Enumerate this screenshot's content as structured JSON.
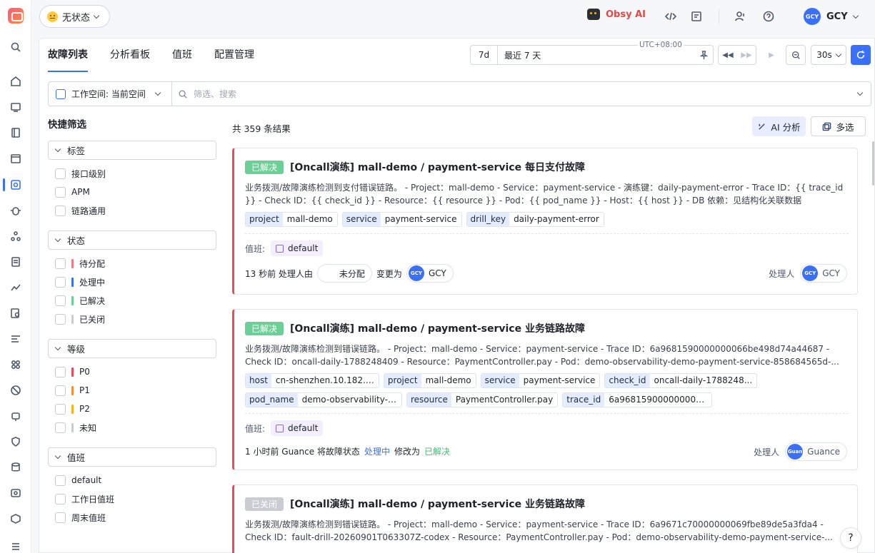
{
  "header": {
    "status_label": "无状态",
    "obsy_label": "Obsy AI",
    "user_initials": "GCY",
    "user_name": "GCY"
  },
  "tabs": [
    {
      "label": "故障列表",
      "active": true
    },
    {
      "label": "分析看板",
      "active": false
    },
    {
      "label": "值班",
      "active": false
    },
    {
      "label": "配置管理",
      "active": false
    }
  ],
  "time": {
    "range": "7d",
    "label": "最近 7 天",
    "timezone": "UTC+08:00",
    "interval": "30s"
  },
  "filter": {
    "workspace": "工作空间: 当前空间",
    "search_placeholder": "筛选、搜索"
  },
  "quick_filter": {
    "title": "快捷筛选",
    "groups": [
      {
        "label": "标签",
        "items": [
          {
            "label": "接口级别"
          },
          {
            "label": "APM"
          },
          {
            "label": "链路通用"
          }
        ]
      },
      {
        "label": "状态",
        "items": [
          {
            "label": "待分配",
            "color": "#f07a86"
          },
          {
            "label": "处理中",
            "color": "#3a6ff7"
          },
          {
            "label": "已解决",
            "color": "#6ccf95"
          },
          {
            "label": "已关闭",
            "color": "#c9ccd2"
          }
        ]
      },
      {
        "label": "等级",
        "items": [
          {
            "label": "P0",
            "color": "#e94b5b"
          },
          {
            "label": "P1",
            "color": "#ff8a3c"
          },
          {
            "label": "P2",
            "color": "#ffb020"
          },
          {
            "label": "未知",
            "color": "#c9ccd2"
          }
        ]
      },
      {
        "label": "值班",
        "items": [
          {
            "label": "default"
          },
          {
            "label": "工作日值班"
          },
          {
            "label": "周末值班"
          }
        ]
      }
    ]
  },
  "results": {
    "count_text": "共 359 条结果",
    "ai_label": "AI 分析",
    "multi_label": "多选"
  },
  "cards": [
    {
      "status": "已解决",
      "title": "[Oncall演练] mall-demo / payment-service 每日支付故障",
      "desc": "业务拨测/故障演练检测到支付错误链路。 - Project：mall-demo - Service：payment-service - 演练键：daily-payment-error - Trace ID：{{ trace_id }} - Check ID：{{ check_id }} - Resource：{{ resource }} - Pod：{{ pod_name }} - Host：{{ host }} - DB 依赖：见结构化关联数据（db_hosts） [查...",
      "tags": [
        {
          "k": "project",
          "v": "mall-demo"
        },
        {
          "k": "service",
          "v": "payment-service"
        },
        {
          "k": "drill_key",
          "v": "daily-payment-error"
        }
      ],
      "oncall_label": "值班:",
      "oncall": "default",
      "activity_time": "13 秒前 处理人由",
      "activity_from": "未分配",
      "activity_mid": "变更为",
      "activity_to_initials": "GCY",
      "activity_to": "GCY",
      "assignee_label": "处理人",
      "assignee_initials": "GCY",
      "assignee": "GCY"
    },
    {
      "status": "已解决",
      "title": "[Oncall演练] mall-demo / payment-service 业务链路故障",
      "desc": "业务拨测/故障演练检测到错误链路。 - Project：mall-demo - Service：payment-service - Trace ID：6a9681590000000066be498d74a44687 - Check ID：oncall-daily-1788248409 - Resource：PaymentController.pay - Pod：demo-observability-demo-payment-service-858684565d-...",
      "tags": [
        {
          "k": "host",
          "v": "cn-shenzhen.10.182.1..."
        },
        {
          "k": "project",
          "v": "mall-demo"
        },
        {
          "k": "service",
          "v": "payment-service"
        },
        {
          "k": "check_id",
          "v": "oncall-daily-1788248..."
        },
        {
          "k": "pod_name",
          "v": "demo-observability-d..."
        },
        {
          "k": "resource",
          "v": "PaymentController.pay"
        },
        {
          "k": "trace_id",
          "v": "6a968159000000006..."
        }
      ],
      "oncall_label": "值班:",
      "oncall": "default",
      "activity_time": "1 小时前 Guance 将故障状态",
      "activity_from": "处理中",
      "activity_mid": "修改为",
      "activity_to": "已解决",
      "assignee_label": "处理人",
      "assignee_initials": "Guan",
      "assignee": "Guance"
    },
    {
      "status": "已关闭",
      "title": "[Oncall演练] mall-demo / payment-service 业务链路故障",
      "desc": "业务拨测/故障演练检测到错误链路。 - Project：mall-demo - Service：payment-service - Trace ID：6a9671c70000000069fbe89de5a3fda4 - Check ID：fault-drill-20260901T063307Z-codex - Resource：PaymentController.pay - Pod：demo-observability-demo-payment-service-..."
    }
  ],
  "help": "?"
}
